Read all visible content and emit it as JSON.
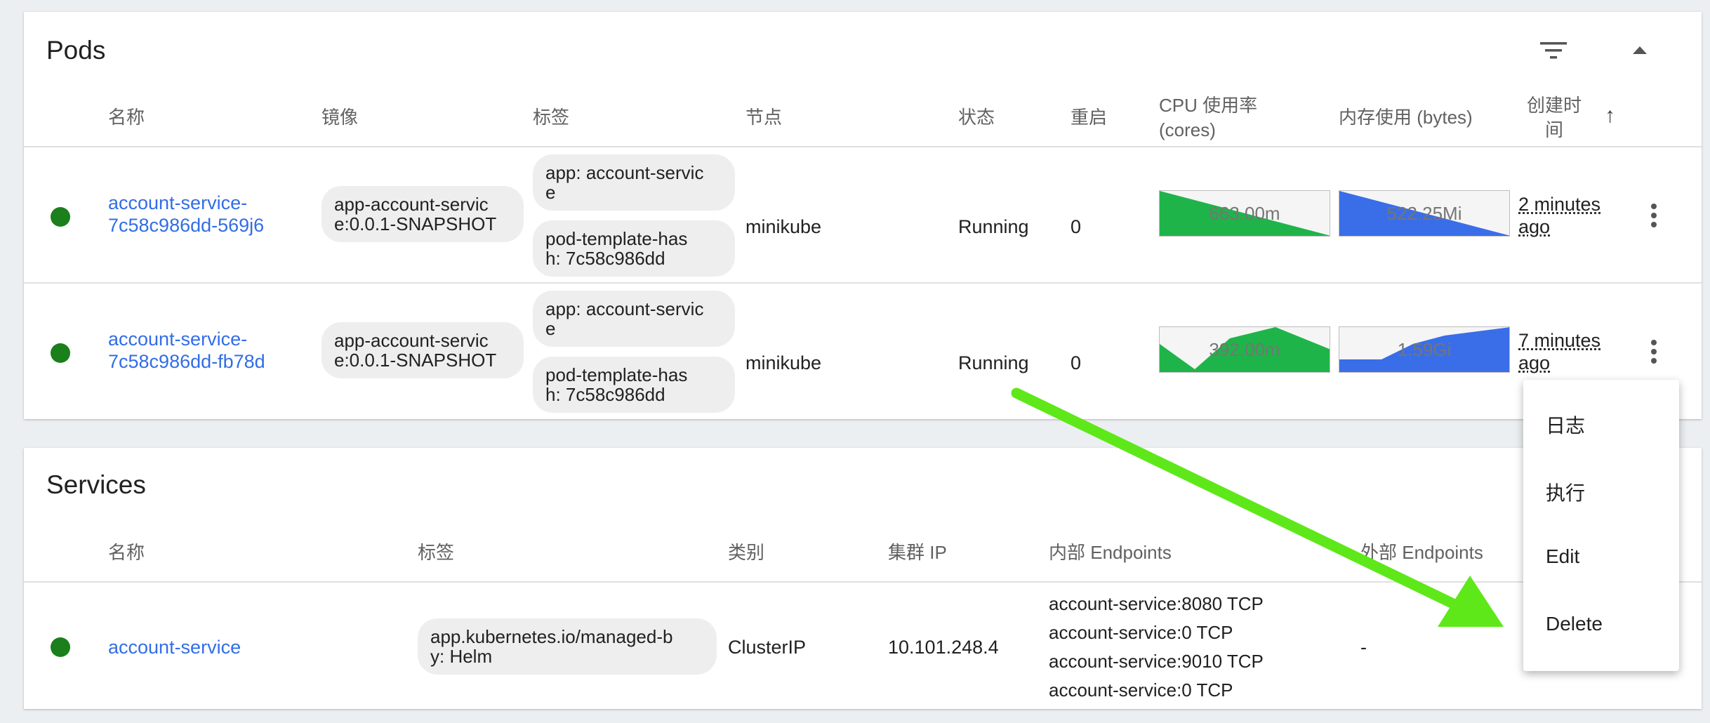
{
  "pods": {
    "title": "Pods",
    "headers": {
      "name": "名称",
      "image": "镜像",
      "labels": "标签",
      "node": "节点",
      "status": "状态",
      "restarts": "重启",
      "cpu_line1": "CPU 使用率",
      "cpu_line2": "(cores)",
      "mem": "内存使用 (bytes)",
      "created_line1": "创建时",
      "created_line2": "间",
      "sort_arrow": "↑"
    },
    "rows": [
      {
        "name_line1": "account-service-",
        "name_line2": "7c58c986dd-569j6",
        "image_line1": "app-account-servic",
        "image_line2": "e:0.0.1-SNAPSHOT",
        "label1_line1": "app: account-servic",
        "label1_line2": "e",
        "label2_line1": "pod-template-has",
        "label2_line2": "h: 7c58c986dd",
        "node": "minikube",
        "status": "Running",
        "restarts": "0",
        "cpu": "663.00m",
        "mem": "522.25Mi",
        "age_line1": "2 minutes",
        "age_line2": "ago"
      },
      {
        "name_line1": "account-service-",
        "name_line2": "7c58c986dd-fb78d",
        "image_line1": "app-account-servic",
        "image_line2": "e:0.0.1-SNAPSHOT",
        "label1_line1": "app: account-servic",
        "label1_line2": "e",
        "label2_line1": "pod-template-has",
        "label2_line2": "h: 7c58c986dd",
        "node": "minikube",
        "status": "Running",
        "restarts": "0",
        "cpu": "392.00m",
        "mem": "1.59Gi",
        "age_line1": "7 minutes",
        "age_line2": "ago"
      }
    ]
  },
  "services": {
    "title": "Services",
    "headers": {
      "name": "名称",
      "labels": "标签",
      "type": "类别",
      "cluster_ip": "集群 IP",
      "internal_endpoints": "内部 Endpoints",
      "external_endpoints": "外部 Endpoints"
    },
    "rows": [
      {
        "name": "account-service",
        "label_line1": "app.kubernetes.io/managed-b",
        "label_line2": "y: Helm",
        "type": "ClusterIP",
        "cluster_ip": "10.101.248.4",
        "internal": [
          "account-service:8080 TCP",
          "account-service:0 TCP",
          "account-service:9010 TCP",
          "account-service:0 TCP"
        ],
        "external": "-"
      }
    ]
  },
  "context_menu": {
    "items": [
      "日志",
      "执行",
      "Edit",
      "Delete"
    ]
  },
  "colors": {
    "link": "#326de6",
    "running_dot": "#1b7f1b",
    "cpu_chart": "#1fb44a",
    "mem_chart": "#3a6ee8",
    "annotation_arrow": "#5ee81a"
  }
}
